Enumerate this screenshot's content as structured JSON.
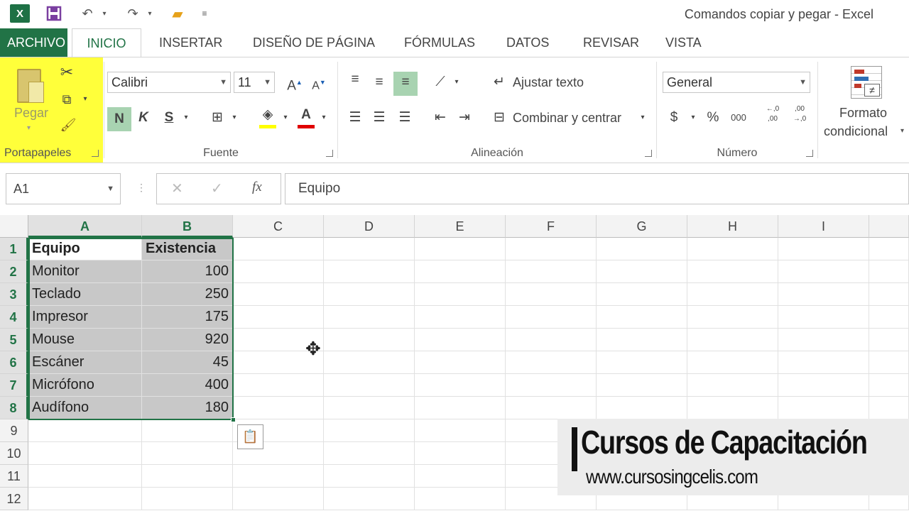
{
  "window": {
    "title": "Comandos copiar y pegar - Excel",
    "app_icon": "X"
  },
  "quick_access": {
    "save_icon": "save-icon",
    "undo_icon": "undo-icon",
    "redo_icon": "redo-icon",
    "open_icon": "folder-icon"
  },
  "tabs": [
    {
      "label": "ARCHIVO"
    },
    {
      "label": "INICIO"
    },
    {
      "label": "INSERTAR"
    },
    {
      "label": "DISEÑO DE PÁGINA"
    },
    {
      "label": "FÓRMULAS"
    },
    {
      "label": "DATOS"
    },
    {
      "label": "REVISAR"
    },
    {
      "label": "VISTA"
    }
  ],
  "ribbon": {
    "clipboard": {
      "label": "Portapapeles",
      "paste_label": "Pegar",
      "highlight_color": "#ffff3a"
    },
    "font": {
      "label": "Fuente",
      "font_name": "Calibri",
      "font_size": "11",
      "bold": "N",
      "italic": "K",
      "underline": "S",
      "grow": "A",
      "shrink": "A",
      "fill_color": "#ffff00",
      "font_color": "#e00000"
    },
    "alignment": {
      "label": "Alineación",
      "wrap_text": "Ajustar texto",
      "merge_center": "Combinar y centrar"
    },
    "number": {
      "label": "Número",
      "format": "General",
      "currency": "$",
      "percent": "%",
      "thousands": "000",
      "inc_decimals": "←,0 ,00",
      "dec_decimals": ",00 →,0"
    },
    "styles": {
      "conditional_format_1": "Formato",
      "conditional_format_2": "condicional"
    }
  },
  "formula_bar": {
    "name_box": "A1",
    "fx": "fx",
    "cancel": "✕",
    "enter": "✓",
    "content": "Equipo"
  },
  "columns": [
    "A",
    "B",
    "C",
    "D",
    "E",
    "F",
    "G",
    "H",
    "I"
  ],
  "rows": [
    "1",
    "2",
    "3",
    "4",
    "5",
    "6",
    "7",
    "8",
    "9",
    "10",
    "11",
    "12"
  ],
  "table": {
    "headers": [
      "Equipo",
      "Existencia"
    ],
    "rows": [
      [
        "Monitor",
        "100"
      ],
      [
        "Teclado",
        "250"
      ],
      [
        "Impresor",
        "175"
      ],
      [
        "Mouse",
        "920"
      ],
      [
        "Escáner",
        "45"
      ],
      [
        "Micrófono",
        "400"
      ],
      [
        "Audífono",
        "180"
      ]
    ]
  },
  "watermark": {
    "title": "Cursos de Capacitación",
    "url": "www.cursosingcelis.com"
  }
}
